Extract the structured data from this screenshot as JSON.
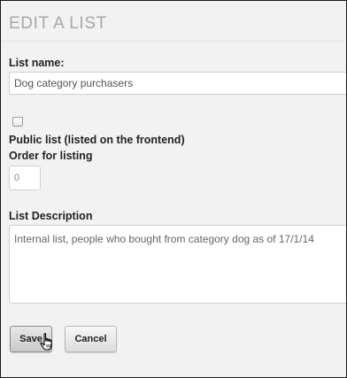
{
  "page": {
    "title": "EDIT A LIST"
  },
  "form": {
    "list_name_label": "List name:",
    "list_name_value": "Dog category purchasers",
    "public_checked": false,
    "public_label": "Public list (listed on the frontend)",
    "order_label": "Order for listing",
    "order_value": "0",
    "description_label": "List Description",
    "description_value": "Internal list, people who bought from category dog as of 17/1/14"
  },
  "actions": {
    "save_label": "Save",
    "cancel_label": "Cancel"
  },
  "icons": {
    "cursor": "hand-pointer-icon"
  },
  "colors": {
    "title": "#a8a8a8",
    "background": "#f2f2f2",
    "input_border": "#cfcfcf"
  }
}
